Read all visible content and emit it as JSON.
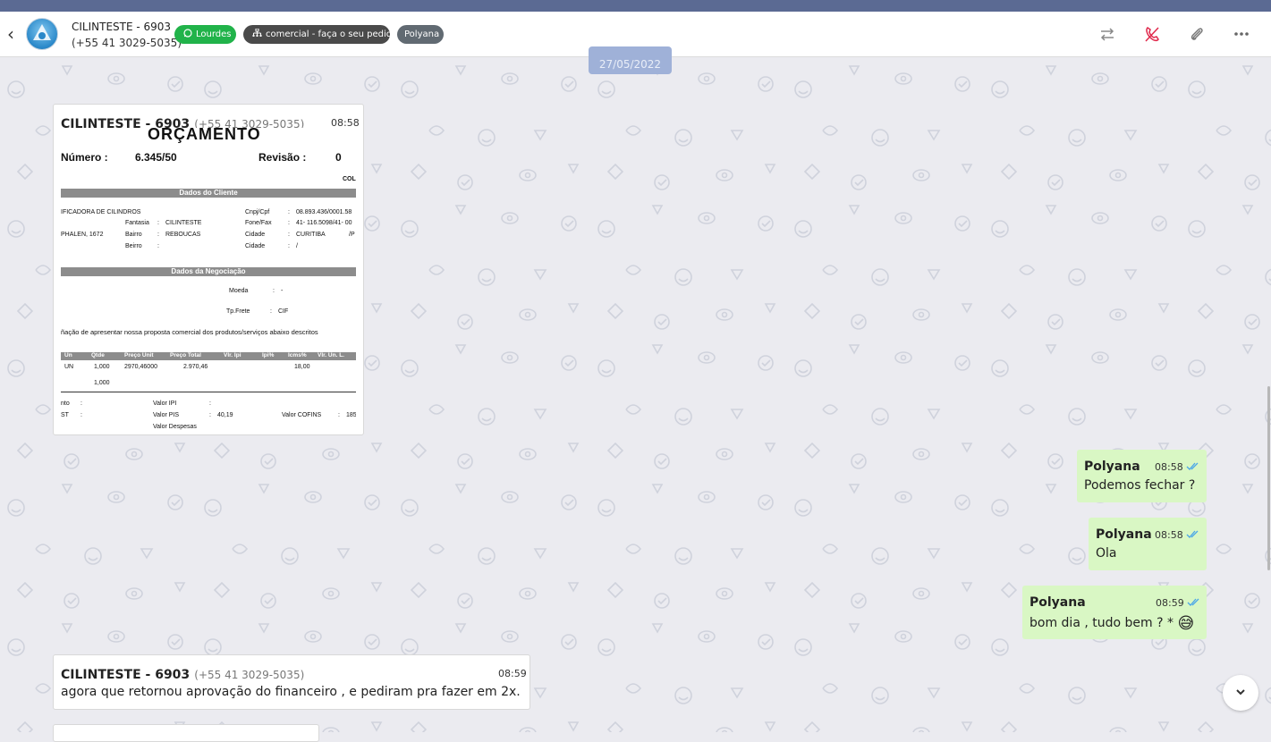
{
  "header": {
    "contact_name": "CILINTESTE - 6903",
    "contact_phone": "(+55 41 3029-5035)",
    "tags": [
      {
        "label": "Lourdes",
        "icon": "whatsapp-icon",
        "color": "#21b34a"
      },
      {
        "label": "comercial - faça o seu pedido",
        "icon": "org-chart-icon",
        "color": "#4a4a4a"
      },
      {
        "label": "Polyana",
        "icon": "",
        "color": "#616a72"
      }
    ],
    "actions": [
      "transfer-icon",
      "end-call-icon",
      "attach-icon",
      "more-icon"
    ]
  },
  "date_separator": "27/05/2022",
  "messages": [
    {
      "sender": "CILINTESTE - 6903",
      "phone": "(+55 41 3029-5035)",
      "time": "08:58",
      "type": "image",
      "document": {
        "heading": "ORÇAMENTO",
        "numero_label": "Número :",
        "numero": "6.345/50",
        "revisao_label": "Revisão :",
        "revisao": "0",
        "col": "COL",
        "section_cliente": "Dados do Cliente",
        "empresa": "IFICADORA DE CILINDROS",
        "fantasia_label": "Fantasia",
        "fantasia": "CILINTESTE",
        "bairro_label": "Bairro",
        "bairro": "REBOUCAS",
        "bairro2_label": "Beirro",
        "endereco": "PHALEN, 1672",
        "cnpj_label": "Cnpj/Cpf",
        "cnpj": "08.893.436/0001.58",
        "fone_label": "Fone/Fax",
        "fone": "41- 116.5098/41- 00",
        "cidade_label": "Cidade",
        "cidade": "CURITIBA",
        "uf": "/P",
        "cidade2_label": "Cidade",
        "cidade2": "/",
        "section_negociacao": "Dados da Negociação",
        "moeda_label": "Moeda",
        "moeda": "-",
        "frete_label": "Tp.Frete",
        "frete": "CIF",
        "texto": "ñação de apresentar nossa proposta comercial dos produtos/serviços abaixo descritos",
        "table_headers": [
          "Un",
          "Qtde",
          "Preço Unit",
          "Preço Total",
          "Vlr. Ipi",
          "Ipi%",
          "Icms%",
          "Vlr. Un. L."
        ],
        "row": [
          "UN",
          "1,000",
          "2970,46000",
          "2.970,46",
          "18,00"
        ],
        "total_qtde": "1,000",
        "foot_nto": "nto",
        "foot_st": "ST",
        "valor_ipi_label": "Valor IPI",
        "valor_pis_label": "Valor PIS",
        "valor_pis": "40,19",
        "valor_cofins_label": "Valor COFINS",
        "valor_cofins": "185",
        "valor_despesas_label": "Valor Despesas"
      }
    },
    {
      "sender": "Polyana",
      "time": "08:58",
      "text": "Podemos fechar ?",
      "status": "read"
    },
    {
      "sender": "Polyana",
      "time": "08:58",
      "text": "Ola",
      "status": "read"
    },
    {
      "sender": "Polyana",
      "time": "08:59",
      "text": "bom dia , tudo bem ? *",
      "emoji": "😅",
      "status": "read"
    },
    {
      "sender": "CILINTESTE - 6903",
      "phone": "(+55 41 3029-5035)",
      "time": "08:59",
      "text": "agora que retornou aprovação do financeiro , e pediram pra fazer em 2x."
    }
  ],
  "colors": {
    "outgoing_bubble": "#d9f7c4",
    "accent_green": "#21b34a",
    "read_ticks": "#4aa6e8",
    "end_call": "#e0284b"
  }
}
